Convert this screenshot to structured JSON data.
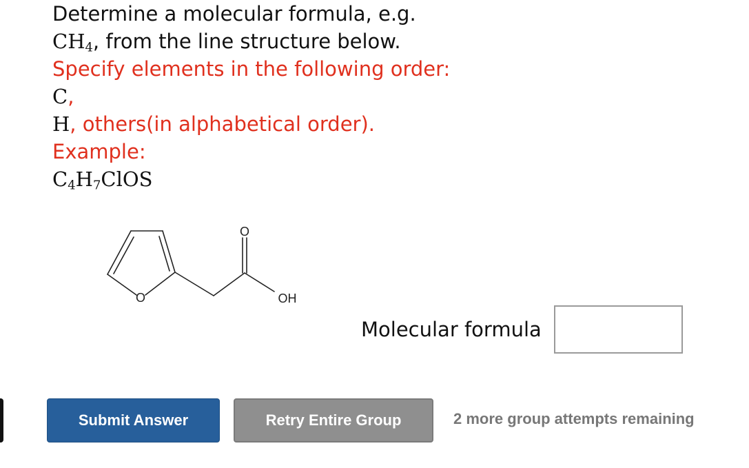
{
  "question": {
    "line1": "Determine a molecular formula, e.g.",
    "line2_formula": {
      "base": "CH",
      "sub": "4"
    },
    "line2_text": ", from the line structure below.",
    "line3": "Specify elements in the following order:",
    "line4_c": "C",
    "line4_comma": ",",
    "line5_h": "H",
    "line5_text": ", others(in alphabetical order).",
    "line6": "Example:",
    "example": {
      "c": "C",
      "c_sub": "4",
      "h": "H",
      "h_sub": "7",
      "rest": "ClOS"
    }
  },
  "structure": {
    "ring_o": "O",
    "carbonyl_o": "O",
    "oh": "OH"
  },
  "answer": {
    "label": "Molecular formula",
    "value": "",
    "placeholder": ""
  },
  "actions": {
    "submit": "Submit Answer",
    "retry": "Retry Entire Group",
    "attempts": "2 more group attempts remaining"
  },
  "colors": {
    "instruction": "#e0301e",
    "submit_bg": "#275f9b",
    "retry_bg": "#8f8f8f",
    "attempts_text": "#777777"
  }
}
